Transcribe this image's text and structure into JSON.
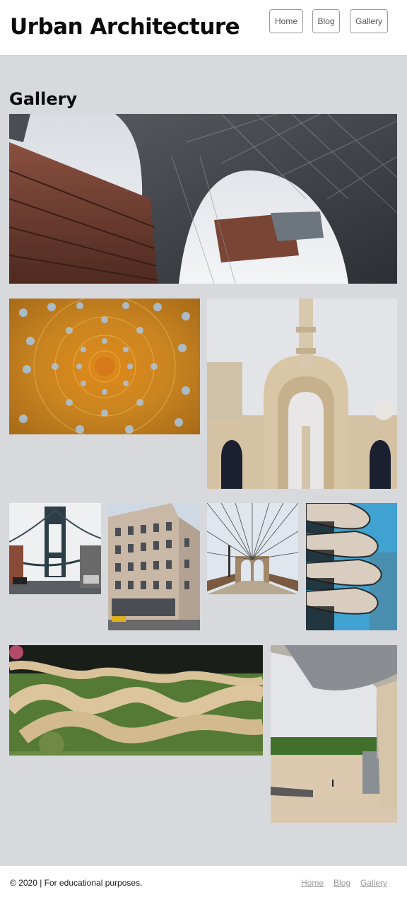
{
  "header": {
    "site_title": "Urban Architecture",
    "nav": [
      {
        "label": "Home"
      },
      {
        "label": "Blog"
      },
      {
        "label": "Gallery"
      }
    ]
  },
  "main": {
    "heading": "Gallery",
    "photos": [
      {
        "subject": "modern arched facade with copper cladding and glass lattice"
      },
      {
        "subject": "ornate golden dome ceiling pattern"
      },
      {
        "subject": "mosque minaret and arched entrance"
      },
      {
        "subject": "Manhattan Bridge tower over street"
      },
      {
        "subject": "historic corner building with cast-iron facade"
      },
      {
        "subject": "Brooklyn Bridge walkway and cables"
      },
      {
        "subject": "curved balcony residential tower"
      },
      {
        "subject": "winding wooden lattice pavilion on lawn"
      },
      {
        "subject": "modern glass museum with stone terrace"
      }
    ]
  },
  "footer": {
    "copyright": "© 2020 | For educational purposes.",
    "links": [
      {
        "label": "Home"
      },
      {
        "label": "Blog"
      },
      {
        "label": "Gallery"
      }
    ]
  },
  "colors": {
    "page_background": "#d7d9dc",
    "header_background": "#ffffff",
    "footer_link": "#9a9a9a",
    "nav_border": "#9a9a9a"
  }
}
